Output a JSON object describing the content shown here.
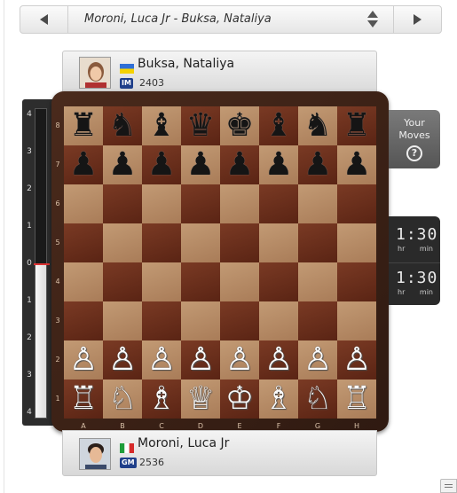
{
  "selector": {
    "game_title": "Moroni, Luca Jr - Buksa, Nataliya"
  },
  "top_player": {
    "name": "Buksa, Nataliya",
    "title": "IM",
    "rating": "2403",
    "flag": "ukraine-flag"
  },
  "bottom_player": {
    "name": "Moroni, Luca Jr",
    "title": "GM",
    "rating": "2536",
    "flag": "italy-flag"
  },
  "eval_bar": {
    "labels_top": [
      "4",
      "3",
      "2",
      "1"
    ],
    "center_label": "0",
    "labels_bottom": [
      "1",
      "2",
      "3",
      "4"
    ],
    "white_share": 0.5
  },
  "board": {
    "ranks": [
      "8",
      "7",
      "6",
      "5",
      "4",
      "3",
      "2",
      "1"
    ],
    "files": [
      "A",
      "B",
      "C",
      "D",
      "E",
      "F",
      "G",
      "H"
    ],
    "position": [
      [
        "r",
        "n",
        "b",
        "q",
        "k",
        "b",
        "n",
        "r"
      ],
      [
        "p",
        "p",
        "p",
        "p",
        "p",
        "p",
        "p",
        "p"
      ],
      [
        "",
        "",
        "",
        "",
        "",
        "",
        "",
        ""
      ],
      [
        "",
        "",
        "",
        "",
        "",
        "",
        "",
        ""
      ],
      [
        "",
        "",
        "",
        "",
        "",
        "",
        "",
        ""
      ],
      [
        "",
        "",
        "",
        "",
        "",
        "",
        "",
        ""
      ],
      [
        "P",
        "P",
        "P",
        "P",
        "P",
        "P",
        "P",
        "P"
      ],
      [
        "R",
        "N",
        "B",
        "Q",
        "K",
        "B",
        "N",
        "R"
      ]
    ]
  },
  "your_moves": {
    "line1": "Your",
    "line2": "Moves",
    "help": "?"
  },
  "clocks": {
    "top": {
      "time": "1:30",
      "unit_hr": "hr",
      "unit_min": "min"
    },
    "bottom": {
      "time": "1:30",
      "unit_hr": "hr",
      "unit_min": "min"
    }
  },
  "colors": {
    "light_square": "#b88c66",
    "dark_square": "#6b2f1c",
    "frame": "#3d2217",
    "badge": "#1f3f8a"
  }
}
